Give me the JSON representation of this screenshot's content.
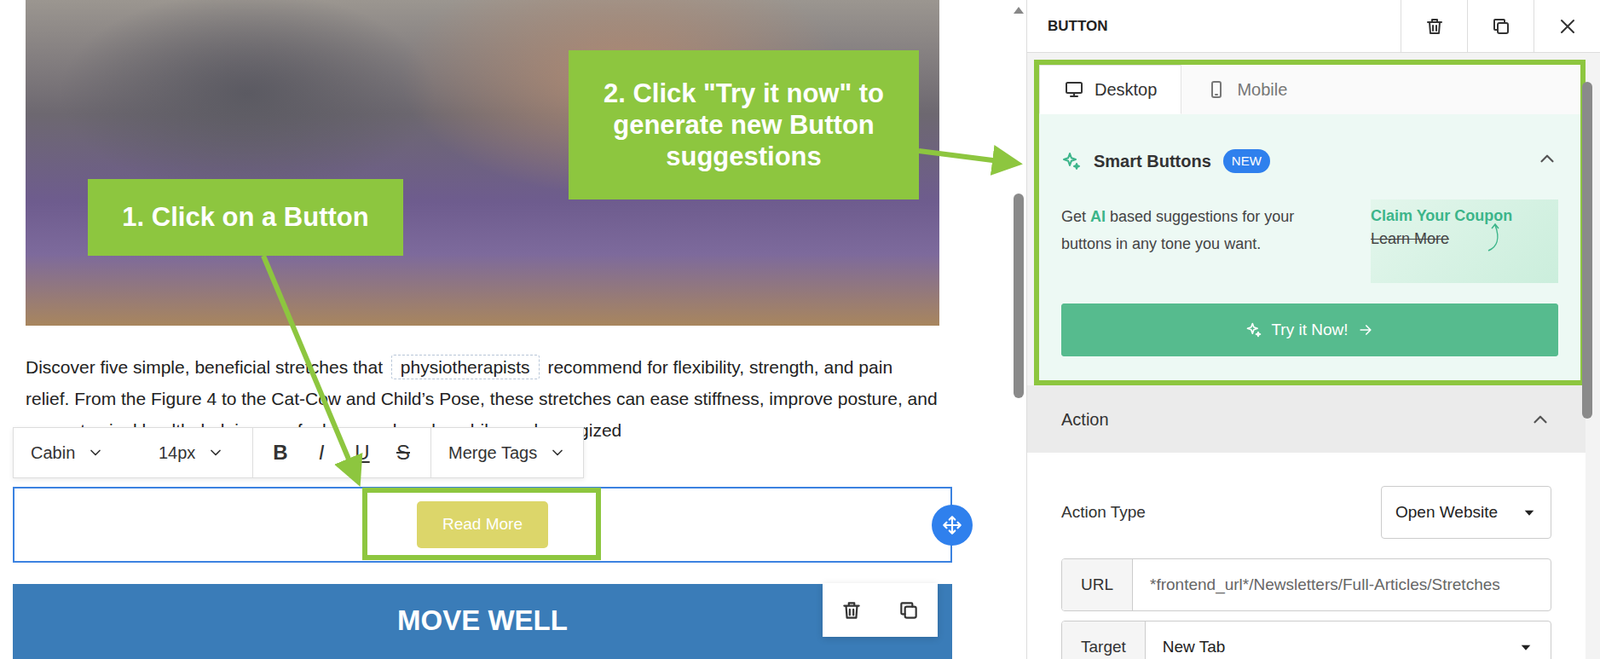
{
  "editor": {
    "paragraph": {
      "before": "Discover five simple, beneficial stretches that ",
      "merge_tag": "physiotherapists",
      "after": " recommend for flexibility, strength, and pain relief. From the Figure 4 to the Cat-Cow and Child’s Pose, these stretches can ease stiffness, improve posture, and support spinal health, helping you feel more relaxed, mobile, and energized"
    },
    "toolbar": {
      "font": "Cabin",
      "size": "14px",
      "format": [
        {
          "label": "B",
          "kind": "bold"
        },
        {
          "label": "I",
          "kind": "italic"
        },
        {
          "label": "U",
          "kind": "underline"
        },
        {
          "label": "S",
          "kind": "strike"
        }
      ],
      "merge_tags": "Merge Tags"
    },
    "button": {
      "label": "Read More",
      "selected": true
    },
    "heading": "MOVE WELL"
  },
  "panel": {
    "title": "BUTTON",
    "tabs": [
      {
        "label": "Desktop",
        "selected": true
      },
      {
        "label": "Mobile",
        "selected": false
      }
    ],
    "smart": {
      "title": "Smart Buttons",
      "badge": "NEW",
      "expanded": true,
      "text_before": "Get ",
      "text_highlight": "AI",
      "text_after": " based suggestions for your buttons in any tone you want.",
      "preview_primary": "Claim Your Coupon",
      "preview_secondary": "Learn More",
      "cta": "Try it Now!"
    },
    "action": {
      "title": "Action",
      "expanded": true,
      "fields": [
        {
          "label": "Action Type",
          "value": "Open Website",
          "kind": "dropdown"
        },
        {
          "label": "URL",
          "value": "*frontend_url*/Newsletters/Full-Articles/Stretches",
          "kind": "text"
        },
        {
          "label": "Target",
          "value": "New Tab",
          "kind": "grouped-dropdown"
        }
      ]
    }
  },
  "annotations": [
    {
      "text": "1. Click on a Button"
    },
    {
      "text": "2. Click \"Try it now\" to generate new Button suggestions"
    }
  ]
}
